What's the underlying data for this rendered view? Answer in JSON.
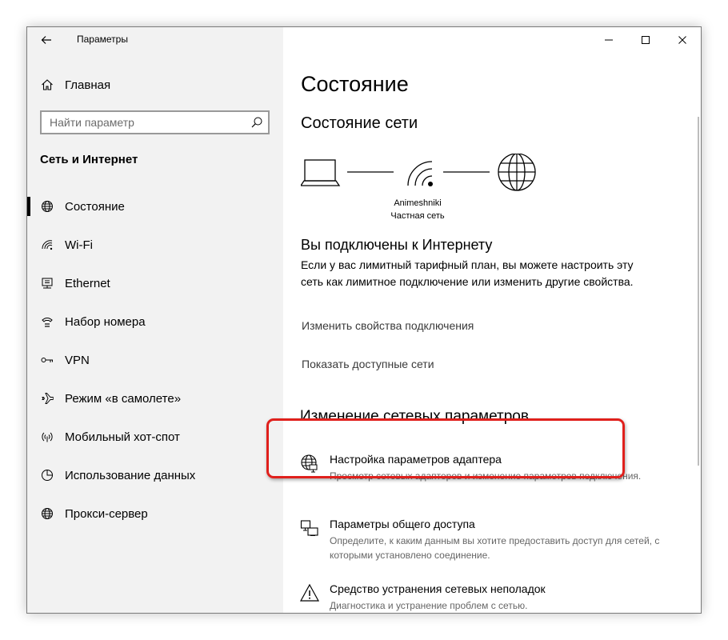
{
  "window": {
    "title": "Параметры",
    "controls": {
      "minimize": "minimize",
      "maximize": "maximize",
      "close": "close"
    }
  },
  "sidebar": {
    "home_label": "Главная",
    "search_placeholder": "Найти параметр",
    "section_label": "Сеть и Интернет",
    "items": [
      {
        "label": "Состояние",
        "icon": "globe-icon",
        "active": true
      },
      {
        "label": "Wi-Fi",
        "icon": "wifi-icon"
      },
      {
        "label": "Ethernet",
        "icon": "ethernet-icon"
      },
      {
        "label": "Набор номера",
        "icon": "dialup-icon"
      },
      {
        "label": "VPN",
        "icon": "vpn-icon"
      },
      {
        "label": "Режим «в самолете»",
        "icon": "airplane-icon"
      },
      {
        "label": "Мобильный хот-спот",
        "icon": "hotspot-icon"
      },
      {
        "label": "Использование данных",
        "icon": "data-usage-icon"
      },
      {
        "label": "Прокси-сервер",
        "icon": "globe-icon"
      }
    ]
  },
  "main": {
    "title": "Состояние",
    "network_status_heading": "Состояние сети",
    "network_name": "Animeshniki",
    "network_type": "Частная сеть",
    "connected_title": "Вы подключены к Интернету",
    "connected_desc": "Если у вас лимитный тарифный план, вы можете настроить эту сеть как лимитное подключение или изменить другие свойства.",
    "link_change_props": "Изменить свойства подключения",
    "link_show_networks": "Показать доступные сети",
    "change_settings_heading": "Изменение сетевых параметров",
    "settings": [
      {
        "title": "Настройка параметров адаптера",
        "desc": "Просмотр сетевых адаптеров и изменение параметров подключения.",
        "icon": "adapter-icon",
        "highlighted": true
      },
      {
        "title": "Параметры общего доступа",
        "desc": "Определите, к каким данным вы хотите предоставить доступ для сетей, с которыми установлено соединение.",
        "icon": "sharing-icon"
      },
      {
        "title": "Средство устранения сетевых неполадок",
        "desc": "Диагностика и устранение проблем с сетью.",
        "icon": "warning-icon"
      }
    ]
  },
  "colors": {
    "highlight": "#e0201c",
    "sidebar_bg": "#f2f2f2",
    "link": "#3a3a3a",
    "desc": "#666666"
  }
}
